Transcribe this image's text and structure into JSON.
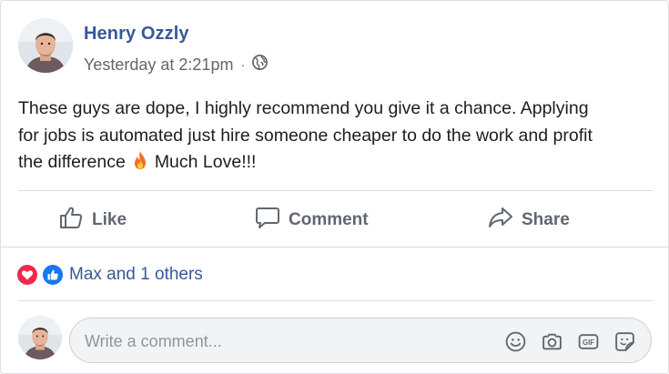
{
  "post": {
    "author": "Henry Ozzly",
    "timestamp": "Yesterday at 2:21pm",
    "separator": "·",
    "privacy_icon": "globe-icon",
    "text_lines": [
      "These guys are dope, I highly recommend you give it a chance. Applying",
      "for jobs is automated just hire someone cheaper to do the work and profit"
    ],
    "text_line3_start": "the difference",
    "text_emoji": "fire-emoji",
    "text_line3_end": "Much Love!!!"
  },
  "actions": {
    "like_label": "Like",
    "comment_label": "Comment",
    "share_label": "Share"
  },
  "reactions": {
    "icons": [
      "love-reaction-icon",
      "like-reaction-icon"
    ],
    "summary": "Max and 1 others"
  },
  "composer": {
    "placeholder": "Write a comment...",
    "value": "",
    "icons": [
      "emoji-icon",
      "camera-icon",
      "gif-icon",
      "sticker-icon"
    ]
  },
  "colors": {
    "author_link": "#385898",
    "meta_text": "#616770",
    "action_text": "#606770",
    "love": "#f0284a",
    "like": "#1877f2",
    "divider": "#dadde1"
  }
}
